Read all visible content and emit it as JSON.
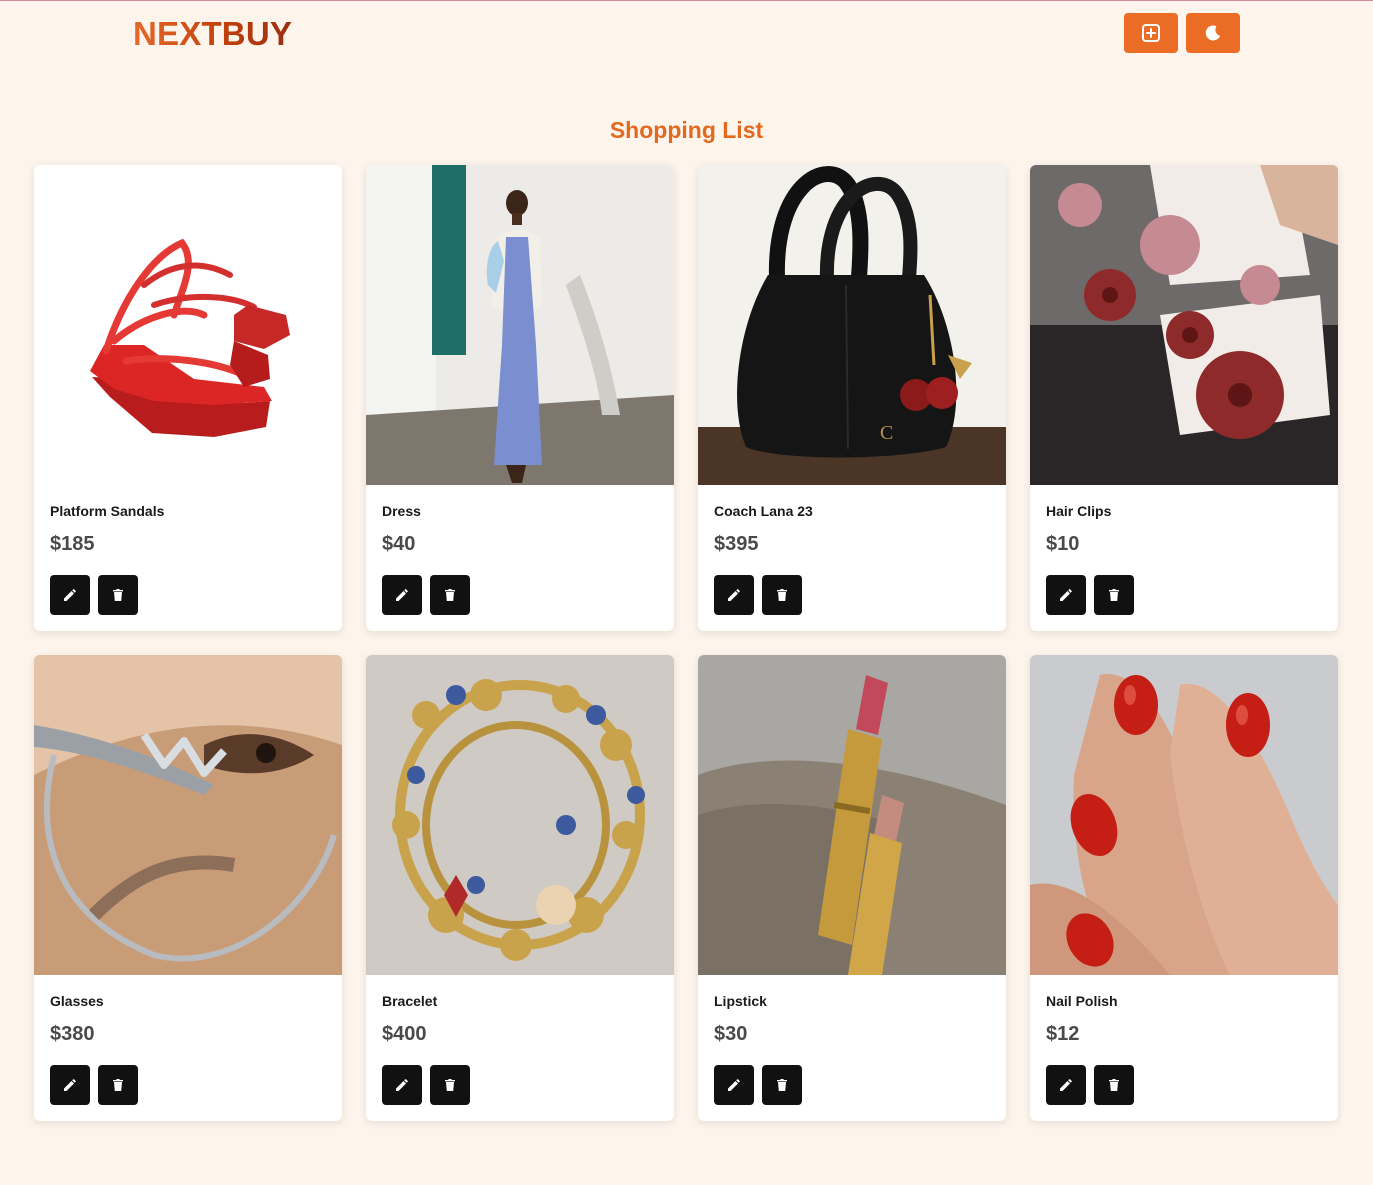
{
  "app": {
    "logo": "NEXTBUY",
    "header_buttons": {
      "add_icon": "plus-square-icon",
      "theme_icon": "moon-icon"
    },
    "accent_color": "#ea6c25"
  },
  "page": {
    "title": "Shopping List"
  },
  "products": [
    {
      "name": "Platform Sandals",
      "price": "$185",
      "image": "red-platform-sandals-photo"
    },
    {
      "name": "Dress",
      "price": "$40",
      "image": "woman-in-blue-dress-photo"
    },
    {
      "name": "Coach Lana 23",
      "price": "$395",
      "image": "black-handbag-with-cherry-charm-photo"
    },
    {
      "name": "Hair Clips",
      "price": "$10",
      "image": "flower-hair-clips-photo"
    },
    {
      "name": "Glasses",
      "price": "$380",
      "image": "metallic-glasses-closeup-photo"
    },
    {
      "name": "Bracelet",
      "price": "$400",
      "image": "charm-bracelet-photo"
    },
    {
      "name": "Lipstick",
      "price": "$30",
      "image": "gold-lipsticks-on-linen-photo"
    },
    {
      "name": "Nail Polish",
      "price": "$12",
      "image": "red-manicured-nails-photo"
    }
  ],
  "card_actions": {
    "edit_icon": "pencil-icon",
    "delete_icon": "trash-icon"
  }
}
